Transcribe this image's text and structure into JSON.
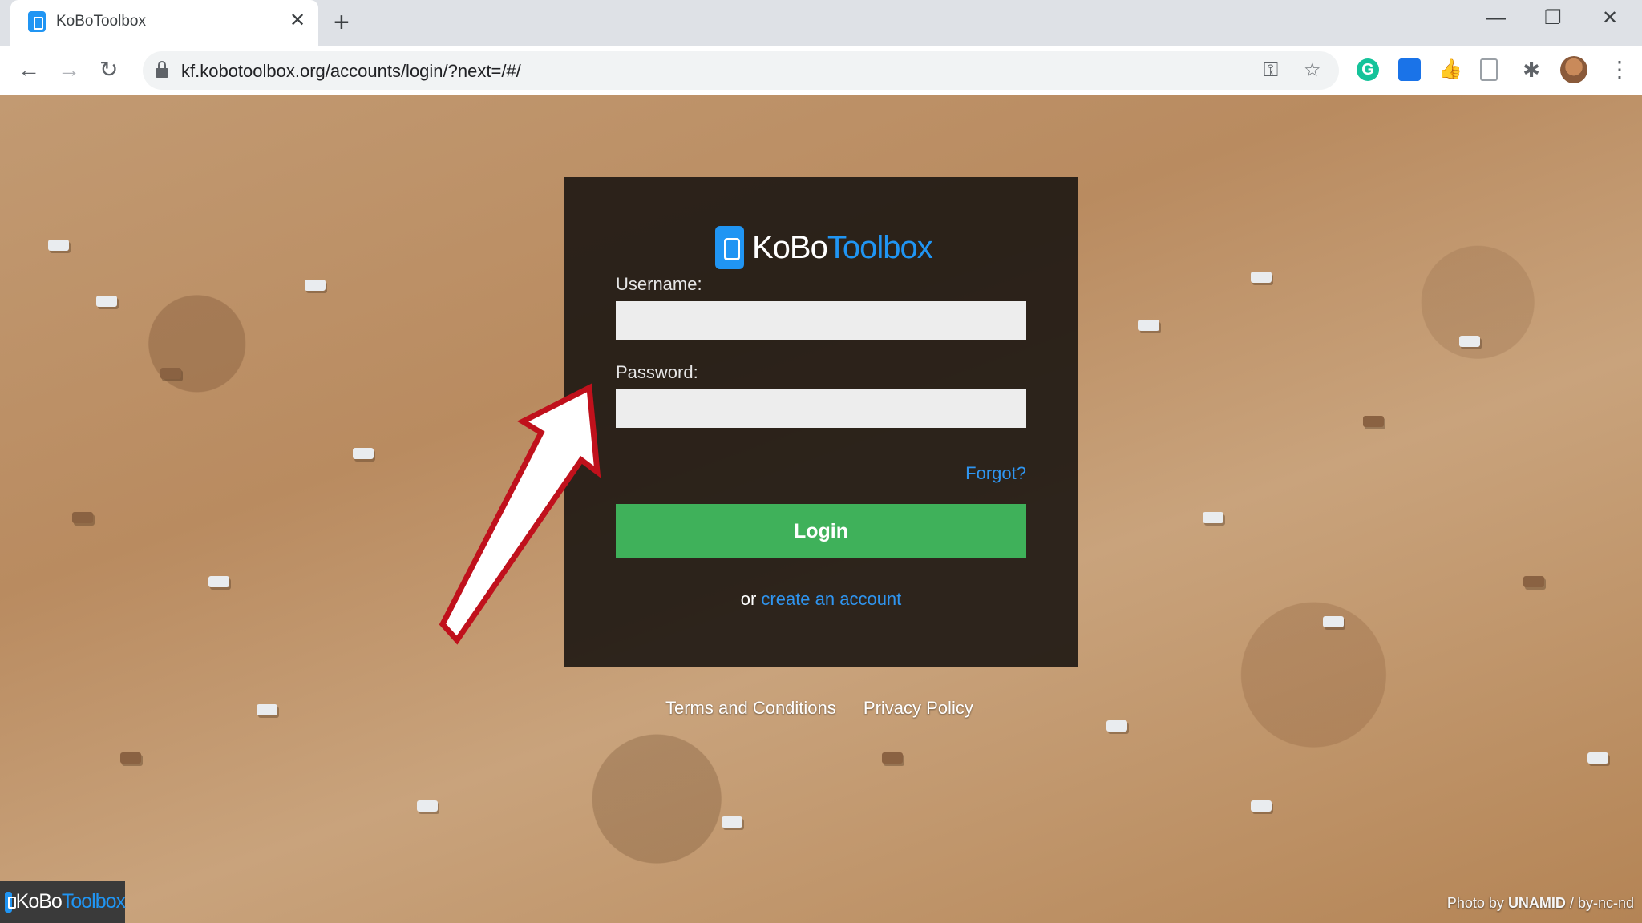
{
  "browser": {
    "tab_title": "KoBoToolbox",
    "tab_close": "✕",
    "new_tab": "+",
    "url": "kf.kobotoolbox.org/accounts/login/?next=/#/",
    "window_minimize": "—",
    "window_restore": "❐",
    "window_close": "✕",
    "back": "←",
    "forward": "→",
    "reload": "↻",
    "key_icon": "⚿",
    "star_icon": "☆",
    "puzzle_icon": "✱",
    "menu_icon": "⋮",
    "ext_grammarly": "G",
    "ext_hand": "👍"
  },
  "login": {
    "logo_kobo": "KoBo",
    "logo_toolbox": "Toolbox",
    "username_label": "Username:",
    "username_value": "",
    "password_label": "Password:",
    "password_value": "",
    "forgot_link": "Forgot?",
    "login_button": "Login",
    "signup_prefix": "or",
    "signup_link": "create an account"
  },
  "footer": {
    "terms": "Terms and Conditions",
    "privacy": "Privacy Policy",
    "corner_kobo": "KoBo",
    "corner_toolbox": "Toolbox",
    "photo_prefix": "Photo by",
    "photo_author": "UNAMID",
    "photo_license": "/ by-nc-nd"
  },
  "colors": {
    "accent": "#2095f3",
    "login_button": "#3fb15a",
    "panel": "#1c1612",
    "arrow": "#c0111c"
  }
}
